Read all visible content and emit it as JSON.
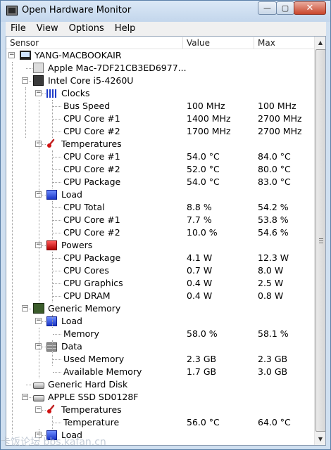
{
  "window": {
    "title": "Open Hardware Monitor",
    "minimize": "—",
    "maximize": "▢",
    "close": "✕"
  },
  "menu": [
    "File",
    "View",
    "Options",
    "Help"
  ],
  "columns": {
    "sensor": "Sensor",
    "value": "Value",
    "max": "Max"
  },
  "rows": [
    {
      "name": "computer",
      "label": "YANG-MACBOOKAIR",
      "level": 0,
      "icon": "computer-icon",
      "expander": "−",
      "value": "",
      "max": ""
    },
    {
      "name": "mainboard",
      "label": "Apple Mac-7DF21CB3ED6977...",
      "level": 1,
      "icon": "mainboard-icon",
      "expander": "",
      "value": "",
      "max": ""
    },
    {
      "name": "cpu",
      "label": "Intel Core i5-4260U",
      "level": 1,
      "icon": "cpu-icon",
      "expander": "−",
      "value": "",
      "max": ""
    },
    {
      "name": "clocks",
      "label": "Clocks",
      "level": 2,
      "icon": "clock-icon",
      "expander": "−",
      "value": "",
      "max": ""
    },
    {
      "name": "bus-speed",
      "label": "Bus Speed",
      "level": 3,
      "icon": "",
      "expander": "",
      "value": "100 MHz",
      "max": "100 MHz"
    },
    {
      "name": "clock-core1",
      "label": "CPU Core #1",
      "level": 3,
      "icon": "",
      "expander": "",
      "value": "1400 MHz",
      "max": "2700 MHz"
    },
    {
      "name": "clock-core2",
      "label": "CPU Core #2",
      "level": 3,
      "icon": "",
      "expander": "",
      "value": "1700 MHz",
      "max": "2700 MHz"
    },
    {
      "name": "temperatures",
      "label": "Temperatures",
      "level": 2,
      "icon": "thermometer-icon",
      "expander": "−",
      "value": "",
      "max": ""
    },
    {
      "name": "temp-core1",
      "label": "CPU Core #1",
      "level": 3,
      "icon": "",
      "expander": "",
      "value": "54.0 °C",
      "max": "84.0 °C"
    },
    {
      "name": "temp-core2",
      "label": "CPU Core #2",
      "level": 3,
      "icon": "",
      "expander": "",
      "value": "52.0 °C",
      "max": "80.0 °C"
    },
    {
      "name": "temp-package",
      "label": "CPU Package",
      "level": 3,
      "icon": "",
      "expander": "",
      "value": "54.0 °C",
      "max": "83.0 °C"
    },
    {
      "name": "load",
      "label": "Load",
      "level": 2,
      "icon": "load-icon",
      "expander": "−",
      "value": "",
      "max": ""
    },
    {
      "name": "load-total",
      "label": "CPU Total",
      "level": 3,
      "icon": "",
      "expander": "",
      "value": "8.8 %",
      "max": "54.2 %"
    },
    {
      "name": "load-core1",
      "label": "CPU Core #1",
      "level": 3,
      "icon": "",
      "expander": "",
      "value": "7.7 %",
      "max": "53.8 %"
    },
    {
      "name": "load-core2",
      "label": "CPU Core #2",
      "level": 3,
      "icon": "",
      "expander": "",
      "value": "10.0 %",
      "max": "54.6 %"
    },
    {
      "name": "powers",
      "label": "Powers",
      "level": 2,
      "icon": "power-icon",
      "expander": "−",
      "value": "",
      "max": ""
    },
    {
      "name": "power-package",
      "label": "CPU Package",
      "level": 3,
      "icon": "",
      "expander": "",
      "value": "4.1 W",
      "max": "12.3 W"
    },
    {
      "name": "power-cores",
      "label": "CPU Cores",
      "level": 3,
      "icon": "",
      "expander": "",
      "value": "0.7 W",
      "max": "8.0 W"
    },
    {
      "name": "power-graphics",
      "label": "CPU Graphics",
      "level": 3,
      "icon": "",
      "expander": "",
      "value": "0.4 W",
      "max": "2.5 W"
    },
    {
      "name": "power-dram",
      "label": "CPU DRAM",
      "level": 3,
      "icon": "",
      "expander": "",
      "value": "0.4 W",
      "max": "0.8 W"
    },
    {
      "name": "generic-memory",
      "label": "Generic Memory",
      "level": 1,
      "icon": "memory-icon",
      "expander": "−",
      "value": "",
      "max": ""
    },
    {
      "name": "mem-load",
      "label": "Load",
      "level": 2,
      "icon": "load-icon",
      "expander": "−",
      "value": "",
      "max": ""
    },
    {
      "name": "memory",
      "label": "Memory",
      "level": 3,
      "icon": "",
      "expander": "",
      "value": "58.0 %",
      "max": "58.1 %"
    },
    {
      "name": "mem-data",
      "label": "Data",
      "level": 2,
      "icon": "data-icon",
      "expander": "−",
      "value": "",
      "max": ""
    },
    {
      "name": "used-memory",
      "label": "Used Memory",
      "level": 3,
      "icon": "",
      "expander": "",
      "value": "2.3 GB",
      "max": "2.3 GB"
    },
    {
      "name": "available-memory",
      "label": "Available Memory",
      "level": 3,
      "icon": "",
      "expander": "",
      "value": "1.7 GB",
      "max": "3.0 GB"
    },
    {
      "name": "generic-hdd",
      "label": "Generic Hard Disk",
      "level": 1,
      "icon": "hard-disk-icon",
      "expander": "",
      "value": "",
      "max": ""
    },
    {
      "name": "apple-ssd",
      "label": "APPLE SSD SD0128F",
      "level": 1,
      "icon": "hard-disk-icon",
      "expander": "−",
      "value": "",
      "max": ""
    },
    {
      "name": "ssd-temperatures",
      "label": "Temperatures",
      "level": 2,
      "icon": "thermometer-icon",
      "expander": "−",
      "value": "",
      "max": ""
    },
    {
      "name": "ssd-temperature",
      "label": "Temperature",
      "level": 3,
      "icon": "",
      "expander": "",
      "value": "56.0 °C",
      "max": "64.0 °C"
    },
    {
      "name": "ssd-load",
      "label": "Load",
      "level": 2,
      "icon": "load-icon",
      "expander": "−",
      "value": "",
      "max": ""
    }
  ],
  "watermark": "卡饭论坛 bbs.kafan.cn",
  "scrollbar": {
    "up": "▲",
    "down": "▼"
  }
}
